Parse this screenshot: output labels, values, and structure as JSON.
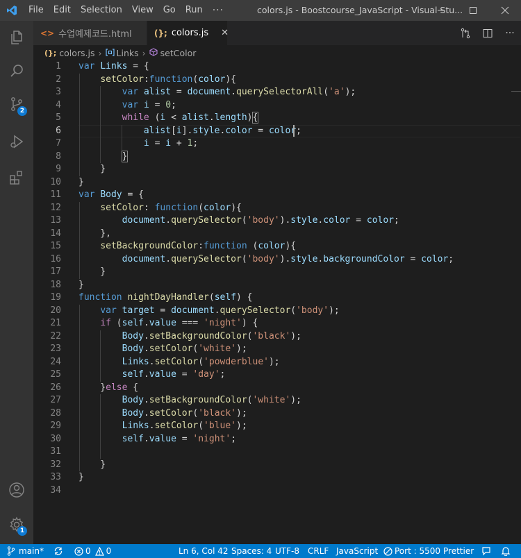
{
  "window": {
    "title": "colors.js - Boostcourse_JavaScript - Visual Stu...",
    "menu": [
      "File",
      "Edit",
      "Selection",
      "View",
      "Go",
      "Run",
      "···"
    ]
  },
  "activity": {
    "source_control_badge": "2",
    "manage_badge": "1"
  },
  "tabs": [
    {
      "label": "수업예제코드.html",
      "icon": "html-file-icon"
    },
    {
      "label": "colors.js",
      "icon": "js-file-icon",
      "active": true
    }
  ],
  "breadcrumb": {
    "file_icon": "(};",
    "file": "colors.js",
    "object": "Links",
    "method": "setColor"
  },
  "editor": {
    "active_line": 6,
    "line_count": 34
  },
  "status": {
    "branch": "main*",
    "errors": "0",
    "warnings": "0",
    "position": "Ln 6, Col 42",
    "spaces": "Spaces: 4",
    "encoding": "UTF-8",
    "eol": "CRLF",
    "language": "JavaScript",
    "port": "Port : 5500",
    "formatter": "Prettier"
  },
  "colors": {
    "statusbar": "#007acc",
    "titlebar": "#3c3c3c",
    "activitybar": "#333333",
    "editor": "#1e1e1e"
  }
}
